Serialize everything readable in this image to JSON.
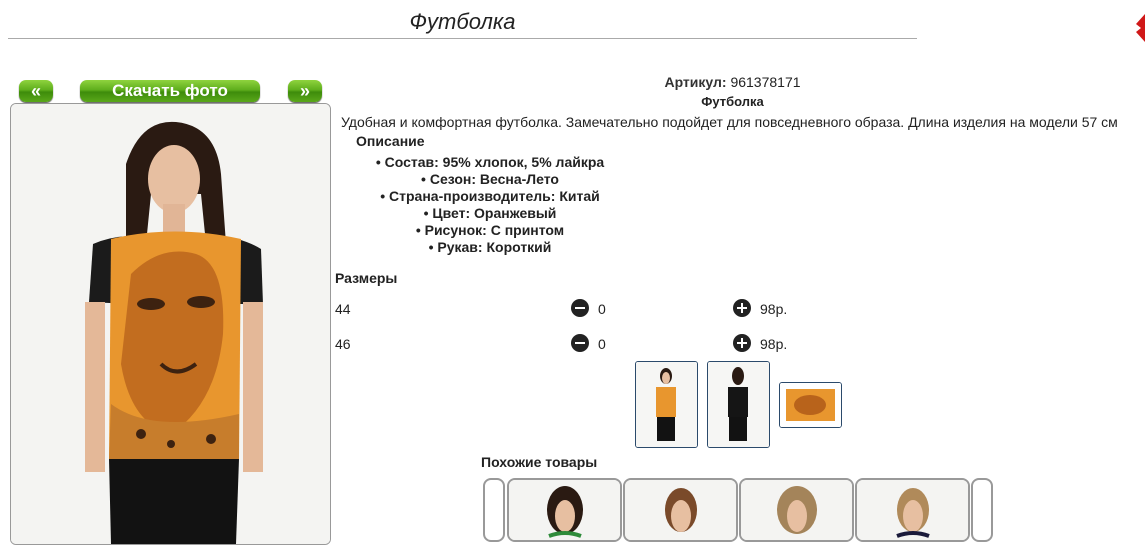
{
  "page": {
    "title": "Футболка"
  },
  "gallery": {
    "prev_label": "«",
    "download_label": "Скачать фото",
    "next_label": "»"
  },
  "product": {
    "article_label": "Артикул:",
    "article_value": "961378171",
    "name": "Футболка",
    "description": "Удобная и комфортная футболка. Замечательно подойдет для повседневного образа. Длина изделия на модели 57 см",
    "description_heading": "Описание",
    "properties": [
      "Состав: 95% хлопок, 5% лайкра",
      "Сезон: Весна-Лето",
      "Страна-производитель: Китай",
      "Цвет: Оранжевый",
      "Рисунок: С принтом",
      "Рукав: Короткий"
    ]
  },
  "sizes": {
    "heading": "Размеры",
    "rows": [
      {
        "size": "44",
        "qty": "0",
        "price": "98р."
      },
      {
        "size": "46",
        "qty": "0",
        "price": "98р."
      }
    ]
  },
  "similar": {
    "heading": "Похожие товары"
  },
  "colors": {
    "button_green": "#5fae1c",
    "print_orange": "#e8962e"
  }
}
